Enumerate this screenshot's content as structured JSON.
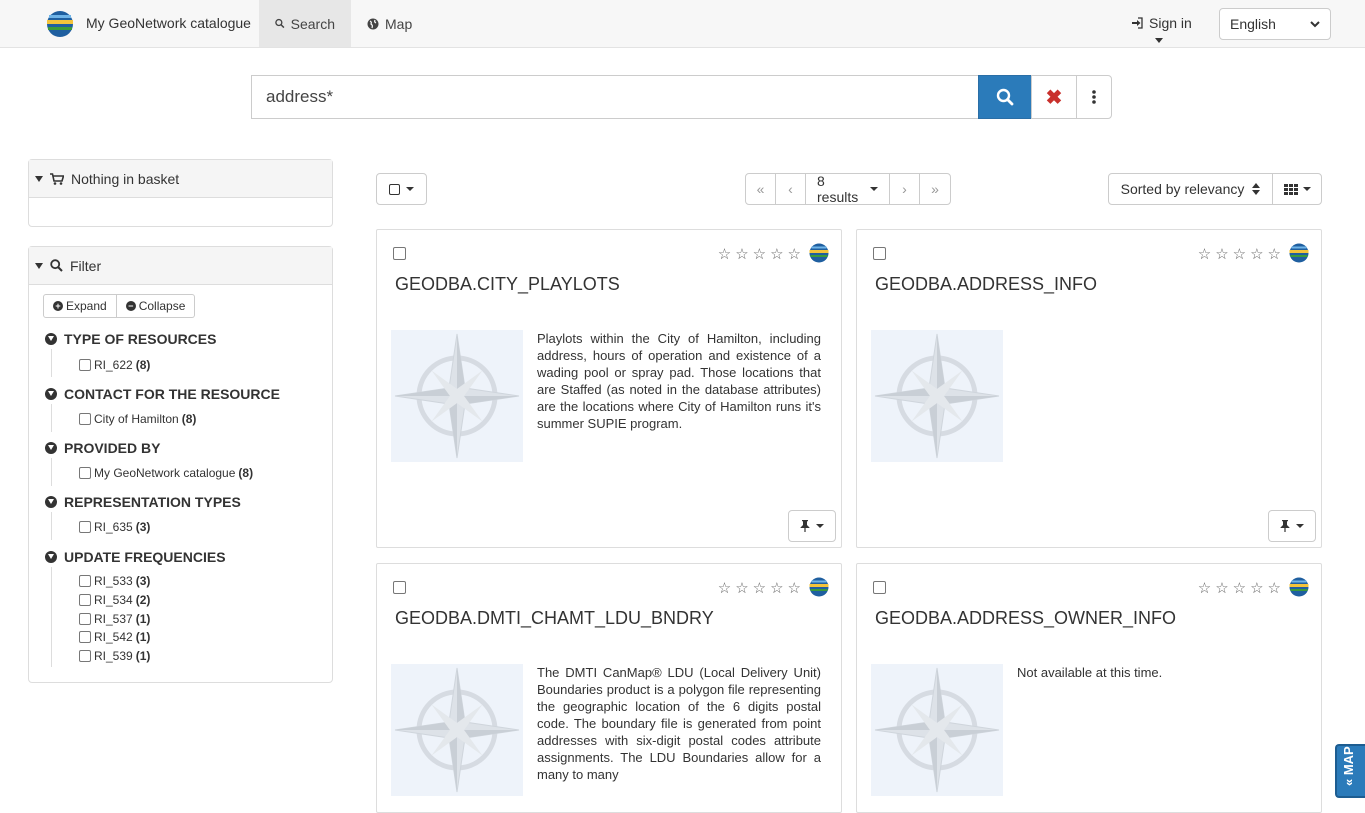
{
  "navbar": {
    "brand": "My GeoNetwork catalogue",
    "tabs": [
      {
        "label": "Search",
        "icon": "search-icon"
      },
      {
        "label": "Map",
        "icon": "globe-icon"
      }
    ],
    "signin": "Sign in",
    "language": "English"
  },
  "search": {
    "query": "address*"
  },
  "basket": {
    "title": "Nothing in basket"
  },
  "filter": {
    "title": "Filter",
    "expand": "Expand",
    "collapse": "Collapse",
    "facets": [
      {
        "title": "TYPE OF RESOURCES",
        "items": [
          {
            "label": "RI_622",
            "count": "(8)"
          }
        ]
      },
      {
        "title": "CONTACT FOR THE RESOURCE",
        "items": [
          {
            "label": "City of Hamilton",
            "count": "(8)"
          }
        ]
      },
      {
        "title": "PROVIDED BY",
        "items": [
          {
            "label": "My GeoNetwork catalogue",
            "count": "(8)"
          }
        ]
      },
      {
        "title": "REPRESENTATION TYPES",
        "items": [
          {
            "label": "RI_635",
            "count": "(3)"
          }
        ]
      },
      {
        "title": "UPDATE FREQUENCIES",
        "items": [
          {
            "label": "RI_533",
            "count": "(3)"
          },
          {
            "label": "RI_534",
            "count": "(2)"
          },
          {
            "label": "RI_537",
            "count": "(1)"
          },
          {
            "label": "RI_542",
            "count": "(1)"
          },
          {
            "label": "RI_539",
            "count": "(1)"
          }
        ]
      }
    ]
  },
  "toolbar": {
    "pager": {
      "first": "«",
      "prev": "‹",
      "count": "8 results",
      "next": "›",
      "last": "»"
    },
    "sort": "Sorted by relevancy"
  },
  "results": [
    {
      "title": "GEODBA.CITY_PLAYLOTS",
      "abstract": "Playlots within the City of Hamilton, including address, hours of operation and existence of a wading pool or spray pad. Those locations that are Staffed (as noted in the database attributes) are the locations where City of Hamilton runs it's summer SUPIE program.",
      "rating": 0
    },
    {
      "title": "GEODBA.ADDRESS_INFO",
      "abstract": "",
      "rating": 0
    },
    {
      "title": "GEODBA.DMTI_CHAMT_LDU_BNDRY",
      "abstract": "The DMTI CanMap® LDU (Local Delivery Unit) Boundaries product is a polygon file representing the geographic location of the 6 digits postal code. The boundary file is generated from point addresses with six-digit postal codes attribute assignments. The LDU Boundaries allow for a many to many",
      "rating": 0
    },
    {
      "title": "GEODBA.ADDRESS_OWNER_INFO",
      "abstract": "Not available at this time.",
      "rating": 0
    }
  ],
  "map_tab": "MAP",
  "colors": {
    "primary": "#2b7bba",
    "danger": "#c9302c",
    "navbar": "#f7f7f7"
  }
}
